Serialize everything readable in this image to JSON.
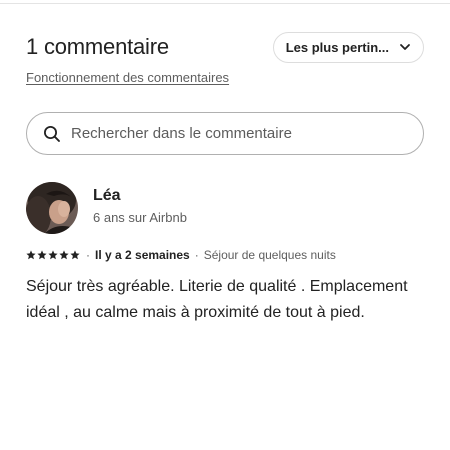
{
  "header": {
    "title": "1 commentaire",
    "sort_label": "Les plus pertin...",
    "how_it_works_link": "Fonctionnement des commentaires"
  },
  "search": {
    "placeholder": "Rechercher dans le commentaire",
    "value": ""
  },
  "reviews": [
    {
      "name": "Léa",
      "meta": "6 ans sur Airbnb",
      "rating": 5,
      "date": "Il y a 2 semaines",
      "stay_type": "Séjour de quelques nuits",
      "text": "Séjour très agréable. Literie de qualité . Emplacement idéal , au calme mais à proximité de tout à pied."
    }
  ],
  "icons": {
    "sort": "chevron-down-icon",
    "search": "search-icon",
    "rating": "star-icon"
  },
  "colors": {
    "text_primary": "#222222",
    "text_secondary": "#5e5e5e",
    "border": "#b0b0b0"
  }
}
